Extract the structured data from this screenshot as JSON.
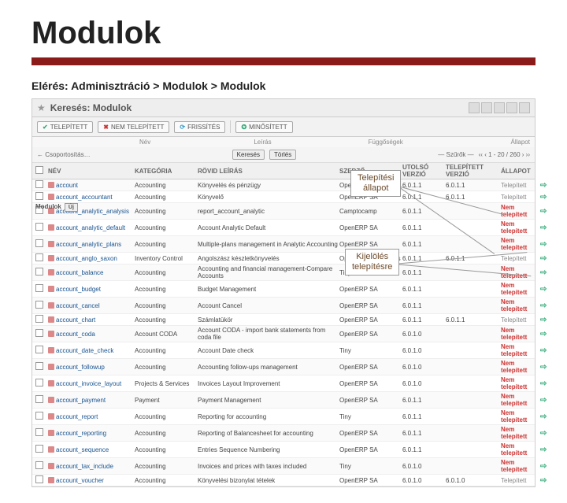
{
  "slide": {
    "title": "Modulok",
    "breadcrumb": "Elérés: Adminisztráció > Modulok > Modulok"
  },
  "searchbar": {
    "label": "Keresés: Modulok"
  },
  "filters": {
    "installed": "TELEPÍTETT",
    "not_installed": "NEM TELEPÍTETT",
    "updates": "FRISSÍTÉS",
    "certified": "MINŐSÍTETT"
  },
  "header_fields": {
    "nev": "Név",
    "leiras": "Leírás",
    "fuggosegek": "Függőségek",
    "allapot": "Állapot"
  },
  "controls": {
    "search": "Keresés",
    "clear": "Törlés",
    "group_label": "← Csoportosítás…",
    "sort_label": "— Szűrők —",
    "pager": "‹‹ ‹ 1 - 20 / 260 › ››"
  },
  "sidebar": {
    "group": "Csoportosítás",
    "mod": "Modulok",
    "new_btn": "Új"
  },
  "table": {
    "headers": {
      "nev": "NÉV",
      "kategoria": "KATEGÓRIA",
      "rovid": "RÖVID LEÍRÁS",
      "szerzo": "SZERZŐ",
      "utolso": "UTOLSÓ VERZIÓ",
      "telepitett": "TELEPÍTETT VERZIÓ",
      "allapot": "ÁLLAPOT"
    },
    "rows": [
      {
        "nev": "account",
        "kat": "Accounting",
        "desc": "Könyvelés és pénzügy",
        "szerzo": "OpenERP SA",
        "uv": "6.0.1.1",
        "tv": "6.0.1.1",
        "status": "Telepített",
        "st": "inst"
      },
      {
        "nev": "account_accountant",
        "kat": "Accounting",
        "desc": "Könyvelő",
        "szerzo": "OpenERP SA",
        "uv": "6.0.1.1",
        "tv": "6.0.1.1",
        "status": "Telepített",
        "st": "inst"
      },
      {
        "nev": "account_analytic_analysis",
        "kat": "Accounting",
        "desc": "report_account_analytic",
        "szerzo": "Camptocamp",
        "uv": "6.0.1.1",
        "tv": "",
        "status": "Nem telepített",
        "st": "ninst"
      },
      {
        "nev": "account_analytic_default",
        "kat": "Accounting",
        "desc": "Account Analytic Default",
        "szerzo": "OpenERP SA",
        "uv": "6.0.1.1",
        "tv": "",
        "status": "Nem telepített",
        "st": "ninst"
      },
      {
        "nev": "account_analytic_plans",
        "kat": "Accounting",
        "desc": "Multiple-plans management in Analytic Accounting",
        "szerzo": "OpenERP SA",
        "uv": "6.0.1.1",
        "tv": "",
        "status": "Nem telepített",
        "st": "ninst"
      },
      {
        "nev": "account_anglo_saxon",
        "kat": "Inventory Control",
        "desc": "Angolszász készletkönyvelés",
        "szerzo": "OpenERP SA, Veritos",
        "uv": "6.0.1.1",
        "tv": "6.0.1.1",
        "status": "Telepített",
        "st": "inst"
      },
      {
        "nev": "account_balance",
        "kat": "Accounting",
        "desc": "Accounting and financial management-Compare Accounts",
        "szerzo": "Tiny",
        "uv": "6.0.1.1",
        "tv": "",
        "status": "Nem telepített",
        "st": "ninst"
      },
      {
        "nev": "account_budget",
        "kat": "Accounting",
        "desc": "Budget Management",
        "szerzo": "OpenERP SA",
        "uv": "6.0.1.1",
        "tv": "",
        "status": "Nem telepített",
        "st": "ninst"
      },
      {
        "nev": "account_cancel",
        "kat": "Accounting",
        "desc": "Account Cancel",
        "szerzo": "OpenERP SA",
        "uv": "6.0.1.1",
        "tv": "",
        "status": "Nem telepített",
        "st": "ninst"
      },
      {
        "nev": "account_chart",
        "kat": "Accounting",
        "desc": "Számlatükör",
        "szerzo": "OpenERP SA",
        "uv": "6.0.1.1",
        "tv": "6.0.1.1",
        "status": "Telepített",
        "st": "inst"
      },
      {
        "nev": "account_coda",
        "kat": "Account CODA",
        "desc": "Account CODA - import bank statements from coda file",
        "szerzo": "OpenERP SA",
        "uv": "6.0.1.0",
        "tv": "",
        "status": "Nem telepített",
        "st": "ninst"
      },
      {
        "nev": "account_date_check",
        "kat": "Accounting",
        "desc": "Account Date check",
        "szerzo": "Tiny",
        "uv": "6.0.1.0",
        "tv": "",
        "status": "Nem telepített",
        "st": "ninst"
      },
      {
        "nev": "account_followup",
        "kat": "Accounting",
        "desc": "Accounting follow-ups management",
        "szerzo": "OpenERP SA",
        "uv": "6.0.1.0",
        "tv": "",
        "status": "Nem telepített",
        "st": "ninst"
      },
      {
        "nev": "account_invoice_layout",
        "kat": "Projects & Services",
        "desc": "Invoices Layout Improvement",
        "szerzo": "OpenERP SA",
        "uv": "6.0.1.0",
        "tv": "",
        "status": "Nem telepített",
        "st": "ninst"
      },
      {
        "nev": "account_payment",
        "kat": "Payment",
        "desc": "Payment Management",
        "szerzo": "OpenERP SA",
        "uv": "6.0.1.1",
        "tv": "",
        "status": "Nem telepített",
        "st": "ninst"
      },
      {
        "nev": "account_report",
        "kat": "Accounting",
        "desc": "Reporting for accounting",
        "szerzo": "Tiny",
        "uv": "6.0.1.1",
        "tv": "",
        "status": "Nem telepített",
        "st": "ninst"
      },
      {
        "nev": "account_reporting",
        "kat": "Accounting",
        "desc": "Reporting of Balancesheet for accounting",
        "szerzo": "OpenERP SA",
        "uv": "6.0.1.1",
        "tv": "",
        "status": "Nem telepített",
        "st": "ninst"
      },
      {
        "nev": "account_sequence",
        "kat": "Accounting",
        "desc": "Entries Sequence Numbering",
        "szerzo": "OpenERP SA",
        "uv": "6.0.1.1",
        "tv": "",
        "status": "Nem telepített",
        "st": "ninst"
      },
      {
        "nev": "account_tax_include",
        "kat": "Accounting",
        "desc": "Invoices and prices with taxes included",
        "szerzo": "Tiny",
        "uv": "6.0.1.0",
        "tv": "",
        "status": "Nem telepített",
        "st": "ninst"
      },
      {
        "nev": "account_voucher",
        "kat": "Accounting",
        "desc": "Könyvelési bizonylat tételek",
        "szerzo": "OpenERP SA",
        "uv": "6.0.1.0",
        "tv": "6.0.1.0",
        "status": "Telepített",
        "st": "inst"
      }
    ]
  },
  "callouts": {
    "c1": "Telepítési\nállapot",
    "c2": "Kijelölés\ntelepítésre"
  }
}
